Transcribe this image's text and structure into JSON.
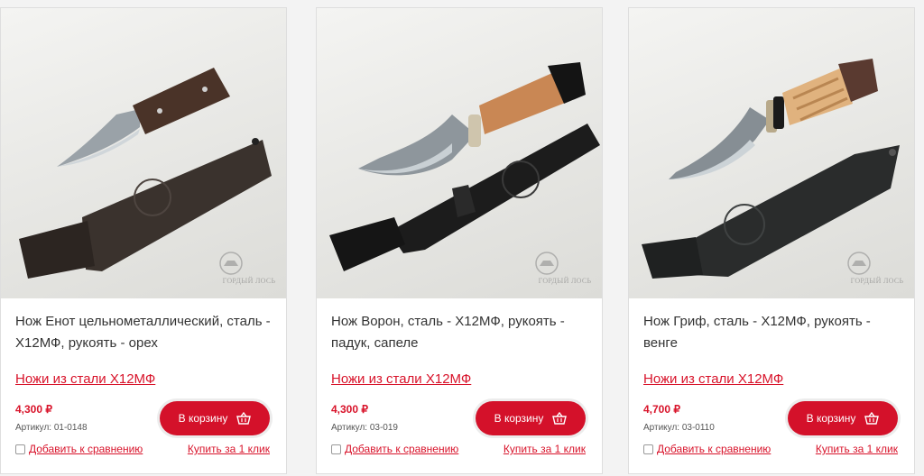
{
  "products": [
    {
      "title": "Нож Ворон, сталь - Х12МФ, рукоять - падук, сапеле",
      "category": "Ножи из стали Х12МФ",
      "price": "4,300 ₽",
      "sku": "Артикул: 03-019",
      "cart_label": "В корзину",
      "compare_label": "Добавить к сравнению",
      "oneclick_label": "Купить за 1 клик",
      "watermark": "ГОРДЫЙ ЛОСЬ"
    },
    {
      "title": "Нож Гриф, сталь - Х12МФ, рукоять - венге",
      "category": "Ножи из стали Х12МФ",
      "price": "4,700 ₽",
      "sku": "Артикул: 03-0110",
      "cart_label": "В корзину",
      "compare_label": "Добавить к сравнению",
      "oneclick_label": "Купить за 1 клик",
      "watermark": "ГОРДЫЙ ЛОСЬ"
    },
    {
      "title": "Нож Енот цельнометаллический, сталь - Х12МФ, рукоять - орех",
      "category": "Ножи из стали Х12МФ",
      "price": "4,300 ₽",
      "sku": "Артикул: 01-0148",
      "cart_label": "В корзину",
      "compare_label": "Добавить к сравнению",
      "oneclick_label": "Купить за 1 клик",
      "watermark": "ГОРДЫЙ ЛОСЬ"
    }
  ],
  "colors": {
    "accent": "#d4112a",
    "link": "#d8132a"
  },
  "icons": {
    "cart": "basket-icon"
  }
}
